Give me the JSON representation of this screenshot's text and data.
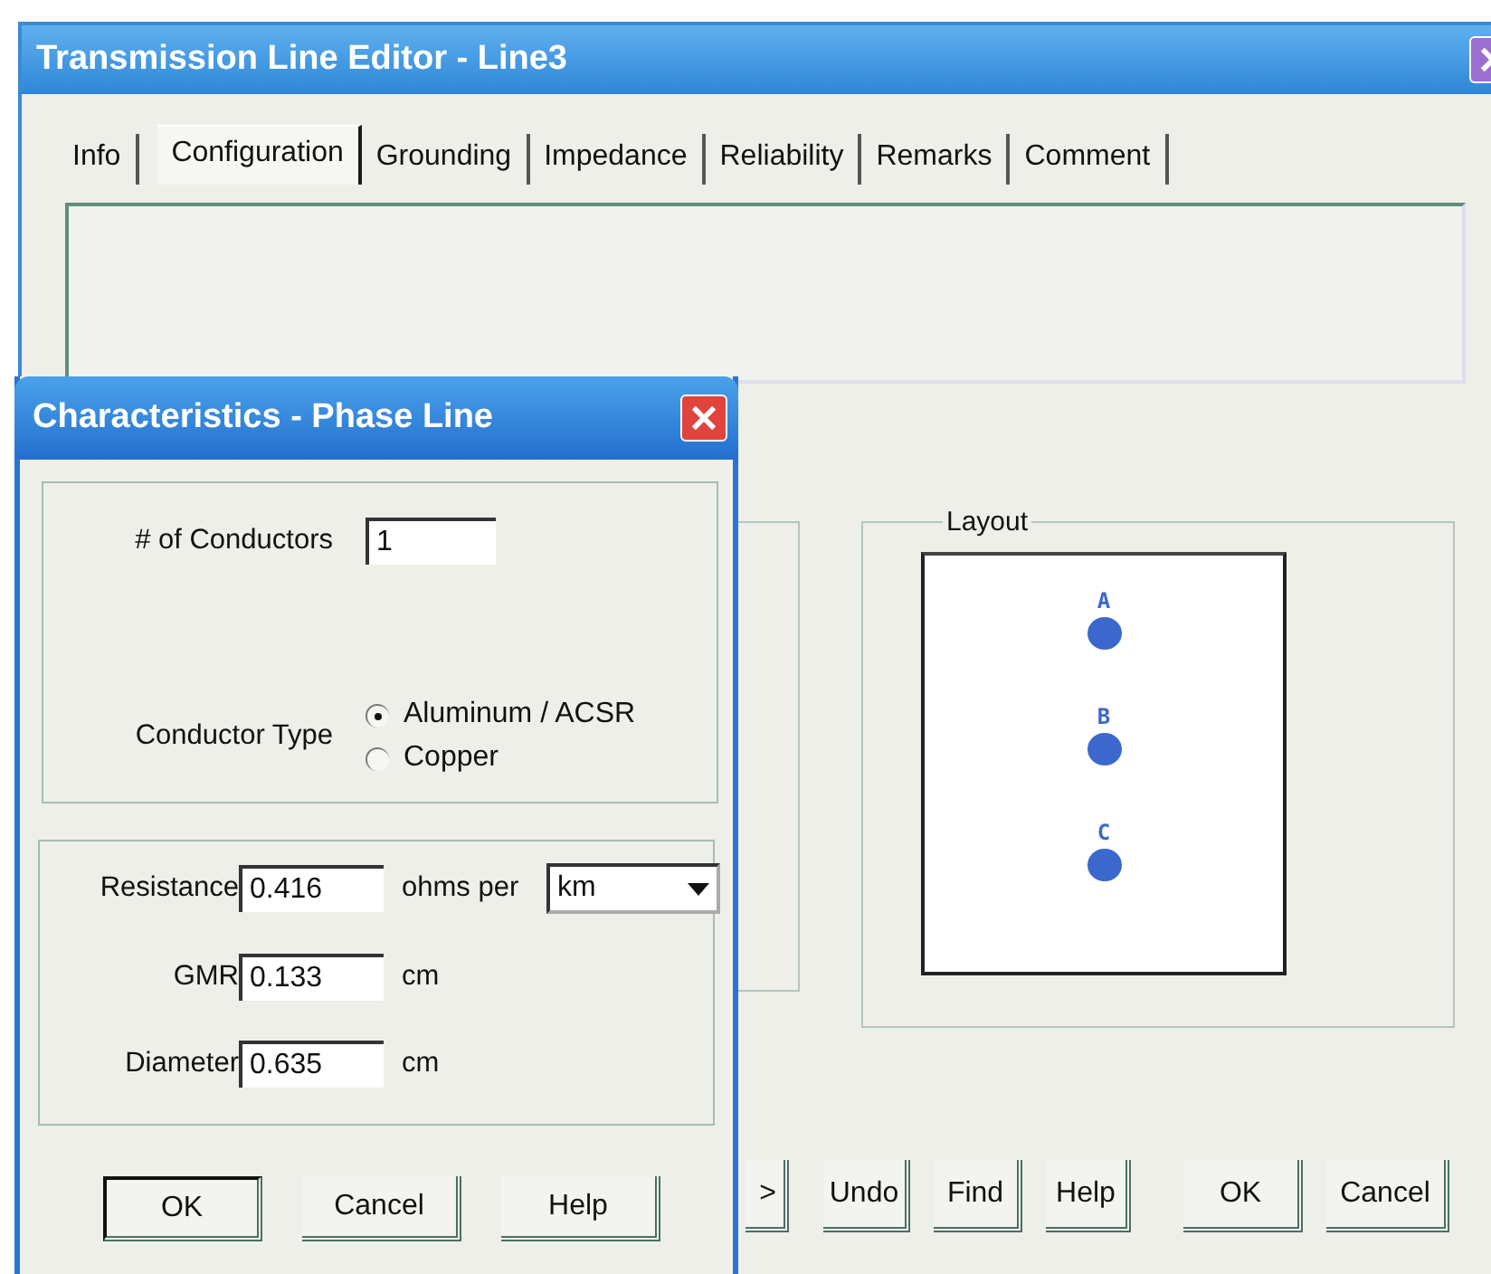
{
  "window": {
    "title": "Transmission Line Editor - Line3"
  },
  "tabs": [
    {
      "label": "Info",
      "selected": false
    },
    {
      "label": "Configuration",
      "selected": true
    },
    {
      "label": "Grounding",
      "selected": false
    },
    {
      "label": "Impedance",
      "selected": false
    },
    {
      "label": "Reliability",
      "selected": false
    },
    {
      "label": "Remarks",
      "selected": false
    },
    {
      "label": "Comment",
      "selected": false
    }
  ],
  "layout": {
    "title": "Layout",
    "phases": [
      {
        "label": "A"
      },
      {
        "label": "B"
      },
      {
        "label": "C"
      }
    ]
  },
  "buttons": [
    ">",
    "Undo",
    "Find",
    "Help",
    "OK",
    "Cancel"
  ],
  "dialog": {
    "title": "Characteristics - Phase Line",
    "conductors_label": "# of Conductors",
    "conductors_value": "1",
    "conductor_type_label": "Conductor Type",
    "conductor_types": [
      {
        "label": "Aluminum / ACSR",
        "selected": true
      },
      {
        "label": "Copper",
        "selected": false
      }
    ],
    "properties": [
      {
        "label": "Resistance",
        "value": "0.416",
        "unit": "ohms per",
        "unit_select": "km"
      },
      {
        "label": "GMR",
        "value": "0.133",
        "unit": "cm"
      },
      {
        "label": "Diameter",
        "value": "0.635",
        "unit": "cm"
      }
    ],
    "buttons": [
      {
        "label": "OK",
        "default": true
      },
      {
        "label": "Cancel",
        "default": false
      },
      {
        "label": "Help",
        "default": false
      }
    ]
  }
}
